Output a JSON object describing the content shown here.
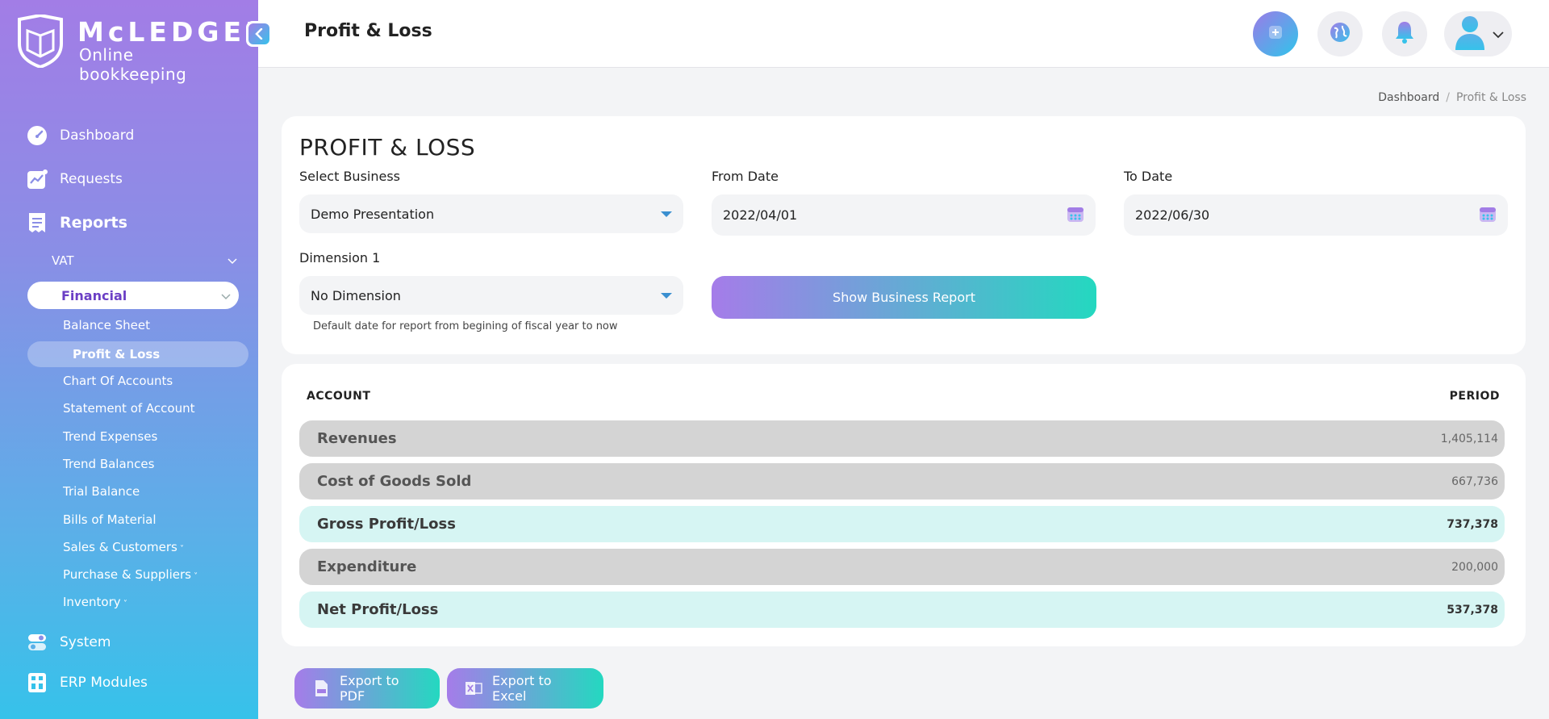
{
  "brand": {
    "name": "McLEDGER",
    "tagline": "Online bookkeeping"
  },
  "header": {
    "title": "Profit & Loss",
    "icons": [
      "plus-icon",
      "globe-icon",
      "bell-icon",
      "user-icon",
      "chevron-down-icon"
    ]
  },
  "sidebar": {
    "items": [
      {
        "label": "Dashboard",
        "icon": "speedometer-icon"
      },
      {
        "label": "Requests",
        "icon": "trend-chart-icon"
      },
      {
        "label": "Reports",
        "icon": "receipt-icon"
      },
      {
        "label": "System",
        "icon": "toggle-icon"
      },
      {
        "label": "ERP Modules",
        "icon": "calculator-icon"
      }
    ],
    "vat_label": "VAT",
    "financial_label": "Financial",
    "financial_links": [
      "Balance Sheet",
      "Profit & Loss",
      "Chart Of Accounts",
      "Statement of Account",
      "Trend Expenses",
      "Trend Balances",
      "Trial Balance",
      "Bills of Material",
      "Sales & Customers",
      "Purchase & Suppliers",
      "Inventory"
    ]
  },
  "breadcrumb": {
    "root": "Dashboard",
    "separator": "/",
    "current": "Profit & Loss"
  },
  "filters": {
    "card_title": "PROFIT & LOSS",
    "business_label": "Select Business",
    "business_value": "Demo Presentation",
    "from_label": "From Date",
    "from_value": "2022/04/01",
    "to_label": "To Date",
    "to_value": "2022/06/30",
    "dimension_label": "Dimension 1",
    "dimension_value": "No Dimension",
    "hint": "Default date for report from begining of fiscal year to now",
    "show_button": "Show Business Report"
  },
  "report": {
    "col_account": "ACCOUNT",
    "col_period": "PERIOD",
    "rows": [
      {
        "label": "Revenues",
        "value": "1,405,114"
      },
      {
        "label": "Cost of Goods Sold",
        "value": "667,736"
      },
      {
        "label": "Gross Profit/Loss",
        "value": "737,378"
      },
      {
        "label": "Expenditure",
        "value": "200,000"
      },
      {
        "label": "Net Profit/Loss",
        "value": "537,378"
      }
    ]
  },
  "exports": {
    "pdf": "Export to PDF",
    "excel": "Export to Excel"
  },
  "colors": {
    "accent_purple": "#a27de6",
    "accent_teal": "#24d8c0",
    "sidebar_bottom": "#36c2ea",
    "active_text": "#6b3fc5"
  }
}
